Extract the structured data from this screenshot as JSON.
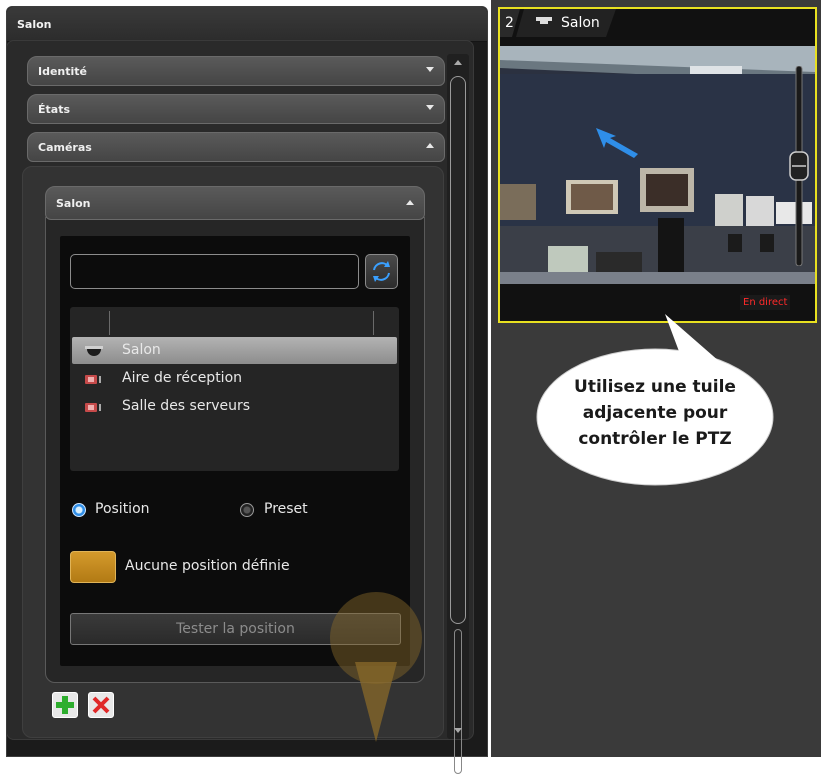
{
  "panel": {
    "title": "Salon"
  },
  "accordion": {
    "identite": "Identité",
    "etats": "États",
    "cameras": "Caméras"
  },
  "camera_box": {
    "title": "Salon"
  },
  "search": {
    "value": "",
    "placeholder": ""
  },
  "camera_list": [
    {
      "name": "Salon",
      "icon": "dome-camera-icon",
      "selected": true
    },
    {
      "name": "Aire de réception",
      "icon": "ptz-camera-icon",
      "selected": false
    },
    {
      "name": "Salle des serveurs",
      "icon": "ptz-camera-icon",
      "selected": false
    }
  ],
  "mode": {
    "position_label": "Position",
    "preset_label": "Preset",
    "selected": "Position"
  },
  "position_status": "Aucune position définie",
  "test_button": "Tester la position",
  "tile": {
    "number": "2",
    "title": "Salon",
    "live_label": "En direct"
  },
  "callout": {
    "line1": "Utilisez une tuile",
    "line2": "adjacente pour",
    "line3": "contrôler le PTZ"
  },
  "colors": {
    "selection_accent": "#2f8ee8",
    "tile_border": "#e8e020",
    "live": "#ff2a2a",
    "swatch": "#c8901f"
  }
}
